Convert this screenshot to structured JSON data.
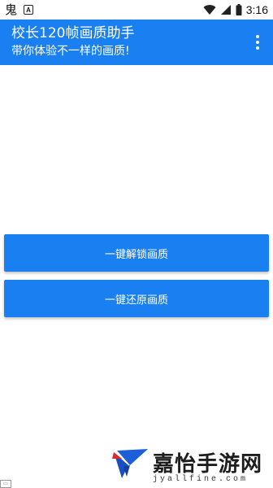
{
  "status_bar": {
    "time": "3:16",
    "notification_icons": [
      "ghost-icon",
      "a-icon"
    ],
    "system_icons": [
      "wifi-icon",
      "signal-icon",
      "battery-icon"
    ]
  },
  "app_bar": {
    "title": "校长120帧画质助手",
    "subtitle": "带你体验不一样的画质!",
    "background": "#1a7ff0",
    "menu_icon": "more-vert-icon"
  },
  "buttons": {
    "unlock_label": "一键解锁画质",
    "restore_label": "一键还原画质",
    "color": "#1a7ff0"
  },
  "watermark": {
    "logo_icon": "bird-logo",
    "text_cn": "嘉怡手游网",
    "text_en": "jyallfine.com"
  }
}
